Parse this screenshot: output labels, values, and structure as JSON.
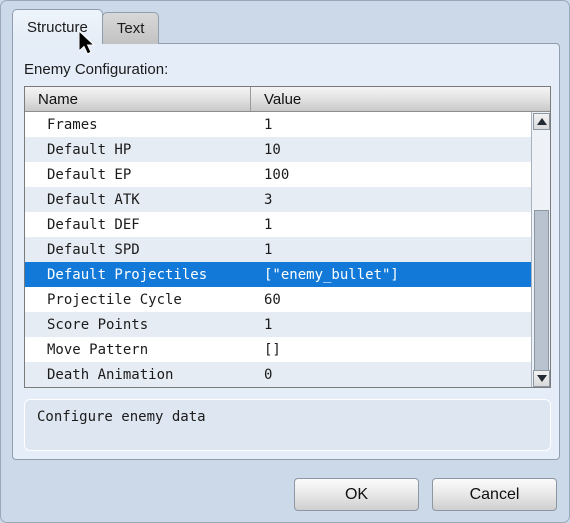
{
  "dialog": {
    "tabs": [
      {
        "label": "Structure",
        "active": true
      },
      {
        "label": "Text",
        "active": false
      }
    ],
    "section_label": "Enemy Configuration:",
    "table": {
      "columns": [
        "Name",
        "Value"
      ],
      "rows": [
        {
          "name": "Frames",
          "value": "1"
        },
        {
          "name": "Default HP",
          "value": "10"
        },
        {
          "name": "Default EP",
          "value": "100"
        },
        {
          "name": "Default ATK",
          "value": "3"
        },
        {
          "name": "Default DEF",
          "value": "1"
        },
        {
          "name": "Default SPD",
          "value": "1"
        },
        {
          "name": "Default Projectiles",
          "value": "[\"enemy_bullet\"]",
          "selected": true
        },
        {
          "name": "Projectile Cycle",
          "value": "60"
        },
        {
          "name": "Score Points",
          "value": "1"
        },
        {
          "name": "Move Pattern",
          "value": "[]"
        },
        {
          "name": "Death Animation",
          "value": "0"
        }
      ]
    },
    "scrollbar": {
      "up_icon": "triangle-up-icon",
      "down_icon": "triangle-down-icon"
    },
    "description": "Configure enemy data",
    "buttons": {
      "ok": "OK",
      "cancel": "Cancel"
    }
  },
  "colors": {
    "window_bg": "#ccd9e8",
    "panel_bg": "#e4edf8",
    "selection": "#1279d8",
    "row_alt": "#e6ecf3"
  }
}
